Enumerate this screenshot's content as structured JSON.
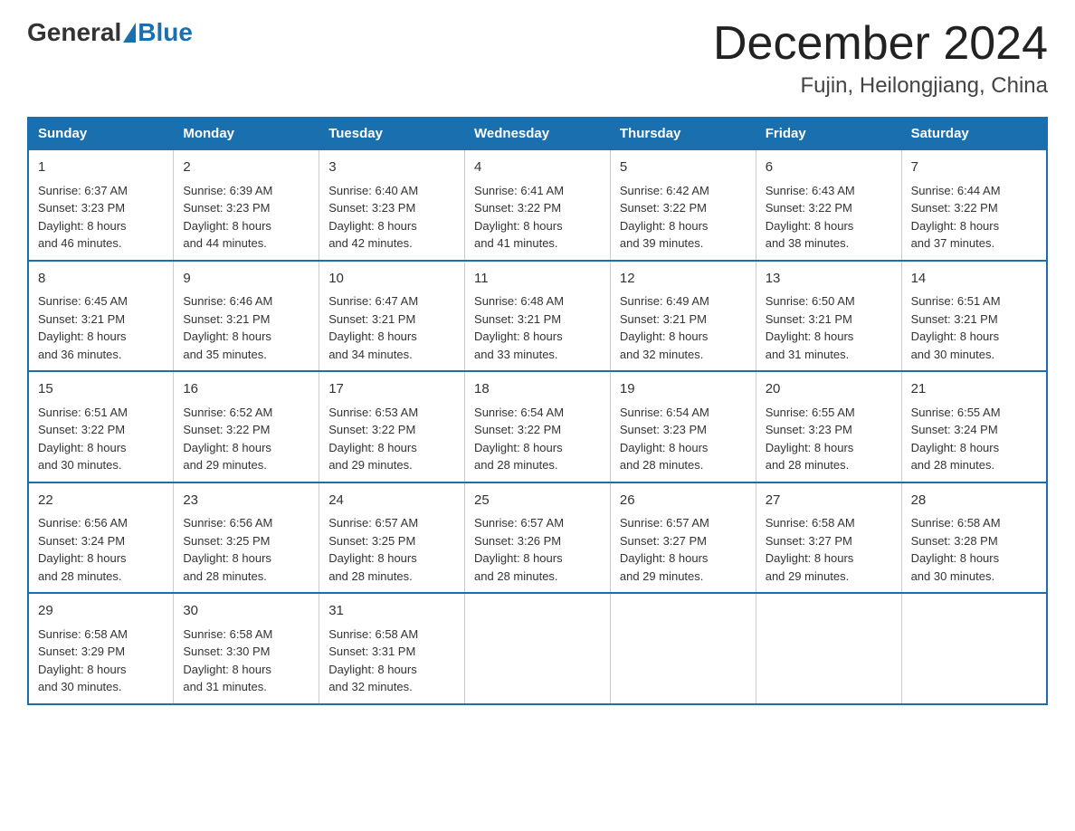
{
  "logo": {
    "general": "General",
    "blue": "Blue"
  },
  "title": "December 2024",
  "location": "Fujin, Heilongjiang, China",
  "days_of_week": [
    "Sunday",
    "Monday",
    "Tuesday",
    "Wednesday",
    "Thursday",
    "Friday",
    "Saturday"
  ],
  "weeks": [
    [
      {
        "day": "1",
        "sunrise": "6:37 AM",
        "sunset": "3:23 PM",
        "daylight": "8 hours and 46 minutes."
      },
      {
        "day": "2",
        "sunrise": "6:39 AM",
        "sunset": "3:23 PM",
        "daylight": "8 hours and 44 minutes."
      },
      {
        "day": "3",
        "sunrise": "6:40 AM",
        "sunset": "3:23 PM",
        "daylight": "8 hours and 42 minutes."
      },
      {
        "day": "4",
        "sunrise": "6:41 AM",
        "sunset": "3:22 PM",
        "daylight": "8 hours and 41 minutes."
      },
      {
        "day": "5",
        "sunrise": "6:42 AM",
        "sunset": "3:22 PM",
        "daylight": "8 hours and 39 minutes."
      },
      {
        "day": "6",
        "sunrise": "6:43 AM",
        "sunset": "3:22 PM",
        "daylight": "8 hours and 38 minutes."
      },
      {
        "day": "7",
        "sunrise": "6:44 AM",
        "sunset": "3:22 PM",
        "daylight": "8 hours and 37 minutes."
      }
    ],
    [
      {
        "day": "8",
        "sunrise": "6:45 AM",
        "sunset": "3:21 PM",
        "daylight": "8 hours and 36 minutes."
      },
      {
        "day": "9",
        "sunrise": "6:46 AM",
        "sunset": "3:21 PM",
        "daylight": "8 hours and 35 minutes."
      },
      {
        "day": "10",
        "sunrise": "6:47 AM",
        "sunset": "3:21 PM",
        "daylight": "8 hours and 34 minutes."
      },
      {
        "day": "11",
        "sunrise": "6:48 AM",
        "sunset": "3:21 PM",
        "daylight": "8 hours and 33 minutes."
      },
      {
        "day": "12",
        "sunrise": "6:49 AM",
        "sunset": "3:21 PM",
        "daylight": "8 hours and 32 minutes."
      },
      {
        "day": "13",
        "sunrise": "6:50 AM",
        "sunset": "3:21 PM",
        "daylight": "8 hours and 31 minutes."
      },
      {
        "day": "14",
        "sunrise": "6:51 AM",
        "sunset": "3:21 PM",
        "daylight": "8 hours and 30 minutes."
      }
    ],
    [
      {
        "day": "15",
        "sunrise": "6:51 AM",
        "sunset": "3:22 PM",
        "daylight": "8 hours and 30 minutes."
      },
      {
        "day": "16",
        "sunrise": "6:52 AM",
        "sunset": "3:22 PM",
        "daylight": "8 hours and 29 minutes."
      },
      {
        "day": "17",
        "sunrise": "6:53 AM",
        "sunset": "3:22 PM",
        "daylight": "8 hours and 29 minutes."
      },
      {
        "day": "18",
        "sunrise": "6:54 AM",
        "sunset": "3:22 PM",
        "daylight": "8 hours and 28 minutes."
      },
      {
        "day": "19",
        "sunrise": "6:54 AM",
        "sunset": "3:23 PM",
        "daylight": "8 hours and 28 minutes."
      },
      {
        "day": "20",
        "sunrise": "6:55 AM",
        "sunset": "3:23 PM",
        "daylight": "8 hours and 28 minutes."
      },
      {
        "day": "21",
        "sunrise": "6:55 AM",
        "sunset": "3:24 PM",
        "daylight": "8 hours and 28 minutes."
      }
    ],
    [
      {
        "day": "22",
        "sunrise": "6:56 AM",
        "sunset": "3:24 PM",
        "daylight": "8 hours and 28 minutes."
      },
      {
        "day": "23",
        "sunrise": "6:56 AM",
        "sunset": "3:25 PM",
        "daylight": "8 hours and 28 minutes."
      },
      {
        "day": "24",
        "sunrise": "6:57 AM",
        "sunset": "3:25 PM",
        "daylight": "8 hours and 28 minutes."
      },
      {
        "day": "25",
        "sunrise": "6:57 AM",
        "sunset": "3:26 PM",
        "daylight": "8 hours and 28 minutes."
      },
      {
        "day": "26",
        "sunrise": "6:57 AM",
        "sunset": "3:27 PM",
        "daylight": "8 hours and 29 minutes."
      },
      {
        "day": "27",
        "sunrise": "6:58 AM",
        "sunset": "3:27 PM",
        "daylight": "8 hours and 29 minutes."
      },
      {
        "day": "28",
        "sunrise": "6:58 AM",
        "sunset": "3:28 PM",
        "daylight": "8 hours and 30 minutes."
      }
    ],
    [
      {
        "day": "29",
        "sunrise": "6:58 AM",
        "sunset": "3:29 PM",
        "daylight": "8 hours and 30 minutes."
      },
      {
        "day": "30",
        "sunrise": "6:58 AM",
        "sunset": "3:30 PM",
        "daylight": "8 hours and 31 minutes."
      },
      {
        "day": "31",
        "sunrise": "6:58 AM",
        "sunset": "3:31 PM",
        "daylight": "8 hours and 32 minutes."
      },
      null,
      null,
      null,
      null
    ]
  ],
  "labels": {
    "sunrise": "Sunrise: ",
    "sunset": "Sunset: ",
    "daylight": "Daylight: "
  }
}
